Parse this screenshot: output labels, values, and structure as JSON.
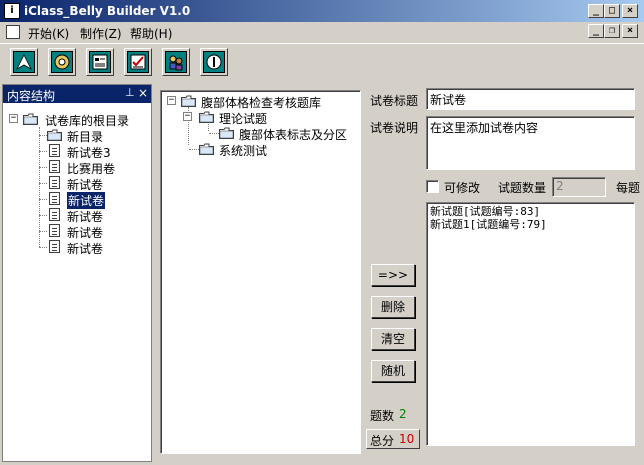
{
  "window": {
    "title": "iClass_Belly Builder V1.0",
    "controls": {
      "minimize": "_",
      "maximize": "□",
      "close": "×"
    }
  },
  "menu": {
    "items": [
      "开始(K)",
      "制作(Z)",
      "帮助(H)"
    ],
    "mdi_controls": {
      "minimize": "_",
      "restore": "❐",
      "close": "×"
    }
  },
  "toolbar": {
    "buttons": [
      {
        "icon": "navigate-up-icon",
        "color": "#008080"
      },
      {
        "icon": "gear-disc-icon",
        "color": "#008080"
      },
      {
        "icon": "form-icon",
        "color": "#008080"
      },
      {
        "icon": "checklist-icon",
        "color": "#008080"
      },
      {
        "icon": "users-icon",
        "color": "#008080"
      },
      {
        "icon": "power-icon",
        "color": "#008080"
      }
    ]
  },
  "left_panel": {
    "title": "内容结构",
    "pin_glyph": "𝌆",
    "close_glyph": "×",
    "root": "试卷库的根目录",
    "items": [
      {
        "label": "新目录",
        "type": "folder"
      },
      {
        "label": "新试卷3",
        "type": "page"
      },
      {
        "label": "比赛用卷",
        "type": "page"
      },
      {
        "label": "新试卷",
        "type": "page"
      },
      {
        "label": "新试卷",
        "type": "page",
        "selected": true
      },
      {
        "label": "新试卷",
        "type": "page"
      },
      {
        "label": "新试卷",
        "type": "page"
      },
      {
        "label": "新试卷",
        "type": "page"
      }
    ]
  },
  "middle_tree": {
    "root": "腹部体格检查考核题库",
    "child1": "理论试题",
    "grandchild": "腹部体表标志及分区",
    "child2": "系统测试"
  },
  "form": {
    "title_label": "试卷标题",
    "title_value": "新试卷",
    "desc_label": "试卷说明",
    "desc_value": "在这里添加试卷内容",
    "editable_label": "可修改",
    "editable_checked": false,
    "count_label": "试题数量",
    "count_value": "2",
    "per_label": "每题"
  },
  "buttons": {
    "add": "=>>",
    "delete": "删除",
    "clear": "清空",
    "random": "随机"
  },
  "question_list": [
    "新试题[试题编号:83]",
    "新试题1[试题编号:79]"
  ],
  "stats": {
    "count_label": "题数",
    "count_value": "2",
    "count_color": "#008000",
    "total_label": "总分",
    "total_value": "10",
    "total_color": "#c00000"
  }
}
